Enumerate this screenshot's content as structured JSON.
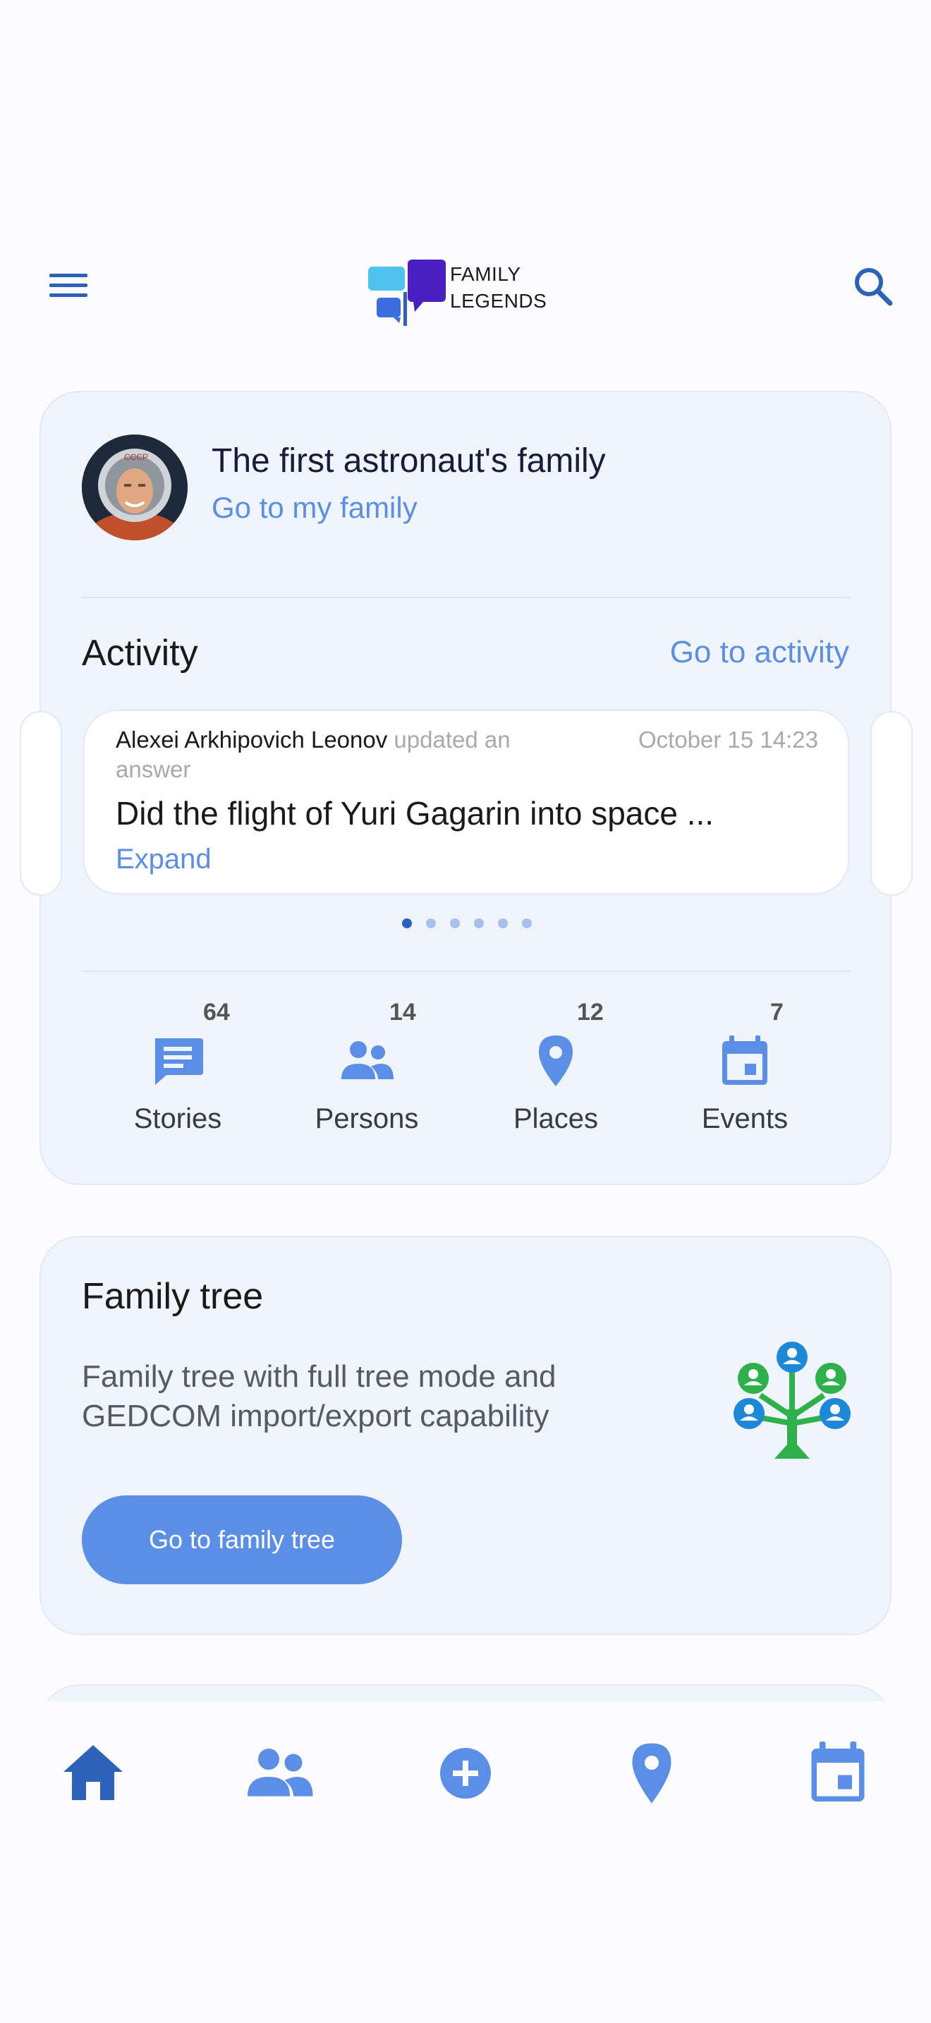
{
  "header": {
    "logo_line1": "FAMILY",
    "logo_line2": "LEGENDS"
  },
  "family": {
    "title": "The first astronaut's family",
    "link": "Go to my family"
  },
  "activity": {
    "title": "Activity",
    "link": "Go to activity",
    "item": {
      "author": "Alexei Arkhipovich Leonov",
      "action_part1": " updated an",
      "action_part2": "answer",
      "date": "October 15 14:23",
      "headline": "Did the flight of Yuri Gagarin into space ...",
      "expand": "Expand"
    },
    "pagination": {
      "total": 6,
      "active": 1
    }
  },
  "stats": [
    {
      "label": "Stories",
      "count": "64",
      "icon": "message-icon"
    },
    {
      "label": "Persons",
      "count": "14",
      "icon": "people-icon"
    },
    {
      "label": "Places",
      "count": "12",
      "icon": "map-pin-icon"
    },
    {
      "label": "Events",
      "count": "7",
      "icon": "calendar-icon"
    }
  ],
  "family_tree": {
    "title": "Family tree",
    "description": "Family tree with full tree mode and GEDCOM import/export capability",
    "button": "Go to family tree"
  },
  "bottom_nav": [
    {
      "name": "home",
      "icon": "home-icon",
      "active": true
    },
    {
      "name": "persons",
      "icon": "people-icon",
      "active": false
    },
    {
      "name": "add",
      "icon": "add-circle-icon",
      "active": false
    },
    {
      "name": "places",
      "icon": "map-pin-icon",
      "active": false
    },
    {
      "name": "events",
      "icon": "calendar-icon",
      "active": false
    }
  ],
  "colors": {
    "accent": "#5b8fe6",
    "primary_dark": "#2e62b8",
    "card_bg": "#f0f4fc",
    "tree_green": "#2eb04a",
    "tree_blue": "#1e88d8"
  }
}
